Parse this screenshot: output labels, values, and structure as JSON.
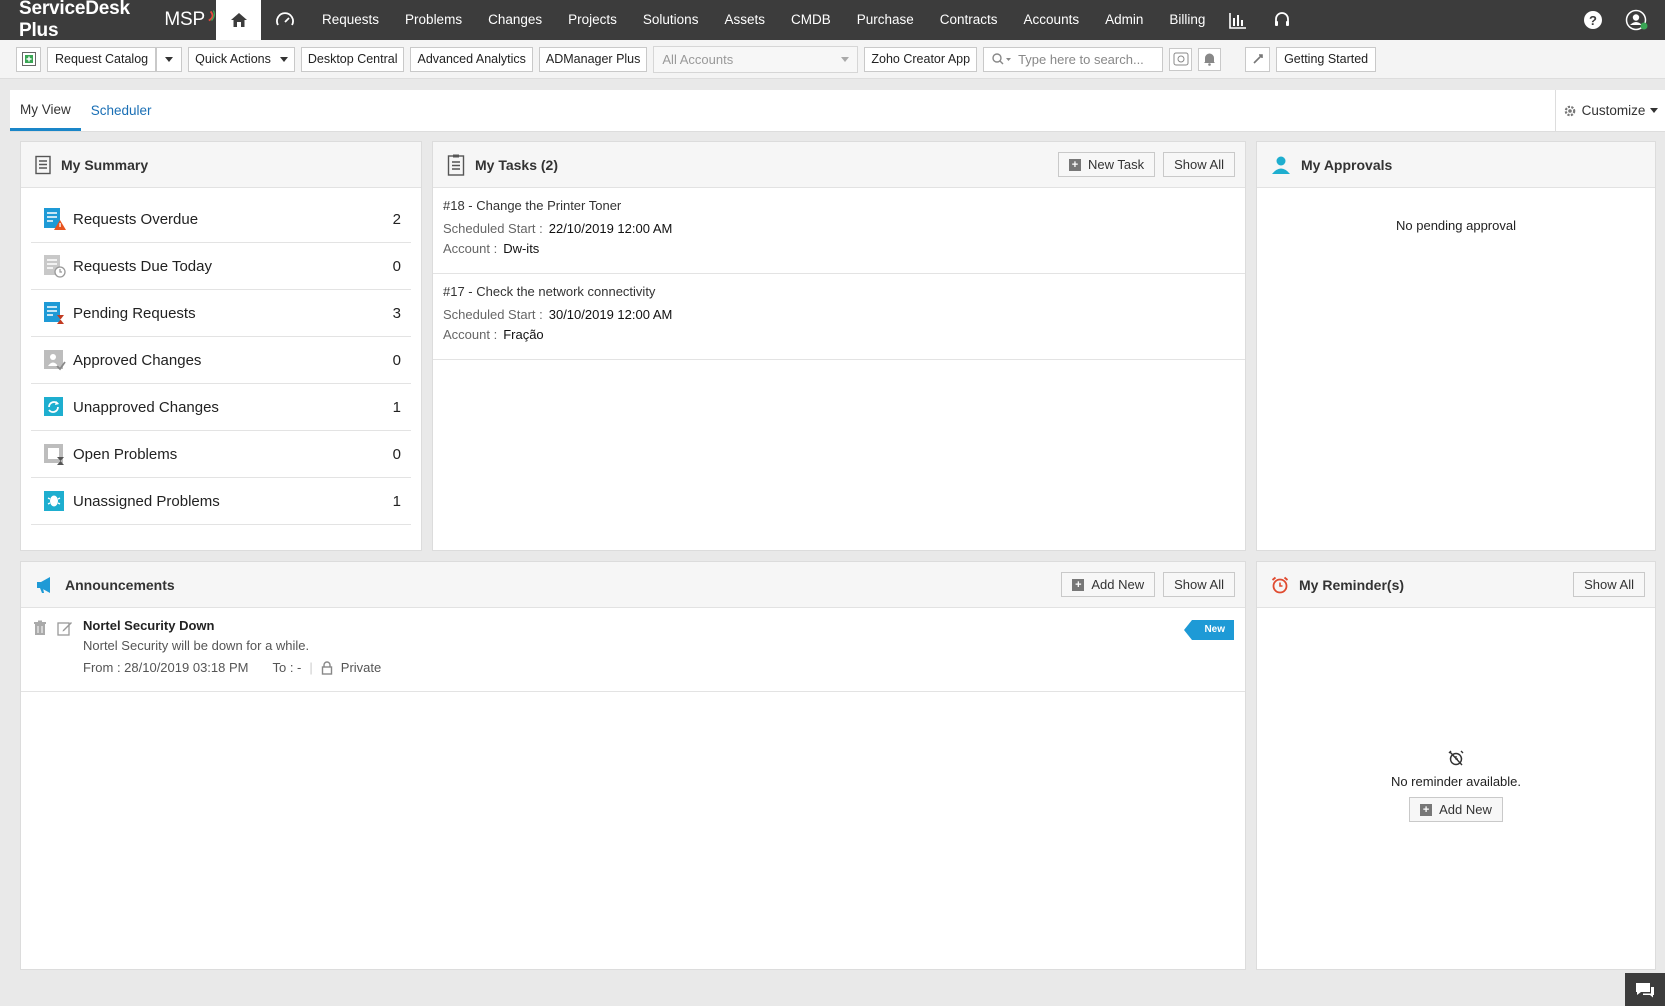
{
  "brand": {
    "name": "ServiceDesk Plus",
    "suffix": "MSP"
  },
  "nav": {
    "items": [
      "Requests",
      "Problems",
      "Changes",
      "Projects",
      "Solutions",
      "Assets",
      "CMDB",
      "Purchase",
      "Contracts",
      "Accounts",
      "Admin",
      "Billing"
    ]
  },
  "toolbar": {
    "request_catalog": "Request Catalog",
    "quick_actions": "Quick Actions",
    "desktop_central": "Desktop Central",
    "advanced_analytics": "Advanced Analytics",
    "admanager_plus": "ADManager Plus",
    "accounts_select": "All Accounts",
    "zoho_creator": "Zoho Creator App",
    "search_placeholder": "Type here to search...",
    "getting_started": "Getting Started"
  },
  "tabs": {
    "my_view": "My View",
    "scheduler": "Scheduler",
    "customize": "Customize"
  },
  "summary": {
    "title": "My Summary",
    "rows": [
      {
        "label": "Requests Overdue",
        "count": "2"
      },
      {
        "label": "Requests Due Today",
        "count": "0"
      },
      {
        "label": "Pending Requests",
        "count": "3"
      },
      {
        "label": "Approved Changes",
        "count": "0"
      },
      {
        "label": "Unapproved Changes",
        "count": "1"
      },
      {
        "label": "Open Problems",
        "count": "0"
      },
      {
        "label": "Unassigned Problems",
        "count": "1"
      }
    ]
  },
  "tasks": {
    "title": "My Tasks (2)",
    "new_task": "New Task",
    "show_all": "Show All",
    "start_label": "Scheduled Start :",
    "account_label": "Account :",
    "items": [
      {
        "title": "#18 - Change the Printer Toner",
        "start": "22/10/2019 12:00 AM",
        "account": "Dw-its"
      },
      {
        "title": "#17 - Check the network connectivity",
        "start": "30/10/2019 12:00 AM",
        "account": "Fração"
      }
    ]
  },
  "approvals": {
    "title": "My Approvals",
    "empty": "No pending approval"
  },
  "announcements": {
    "title": "Announcements",
    "add_new": "Add New",
    "show_all": "Show All",
    "items": [
      {
        "title": "Nortel Security Down",
        "desc": "Nortel Security will be down for a while.",
        "from": "From : 28/10/2019 03:18 PM",
        "to": "To : -",
        "visibility": "Private",
        "badge": "New"
      }
    ]
  },
  "reminders": {
    "title": "My Reminder(s)",
    "show_all": "Show All",
    "empty": "No reminder available.",
    "add_new": "Add New"
  },
  "colors": {
    "nav_bg": "#3c3c3c",
    "accent": "#1a86c8",
    "badge": "#1e9ad6"
  }
}
